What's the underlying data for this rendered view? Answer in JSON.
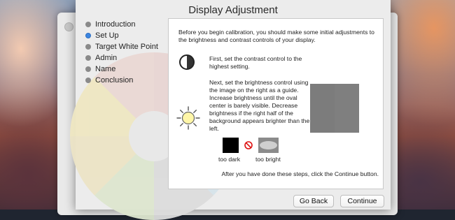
{
  "dialog": {
    "title": "Display Adjustment"
  },
  "sidebar": {
    "steps": [
      {
        "label": "Introduction"
      },
      {
        "label": "Set Up",
        "active": true
      },
      {
        "label": "Target White Point"
      },
      {
        "label": "Admin"
      },
      {
        "label": "Name"
      },
      {
        "label": "Conclusion"
      }
    ]
  },
  "panel": {
    "intro": "Before you begin calibration, you should make some initial adjustments to the brightness and contrast controls of your display.",
    "contrast_text": "First, set the contrast control to the highest setting.",
    "brightness_text": "Next, set the brightness control using the image on the right as a guide.  Increase brightness until the oval center is barely visible.  Decrease brightness if the right half of the background appears brighter than the left.",
    "too_dark_label": "too dark",
    "too_bright_label": "too bright",
    "footer_text": "After you have done these steps, click the Continue button."
  },
  "buttons": {
    "go_back": "Go Back",
    "continue": "Continue"
  },
  "icons": {
    "contrast": "contrast-icon",
    "brightness": "sun-icon",
    "prohibited": "no-icon"
  }
}
